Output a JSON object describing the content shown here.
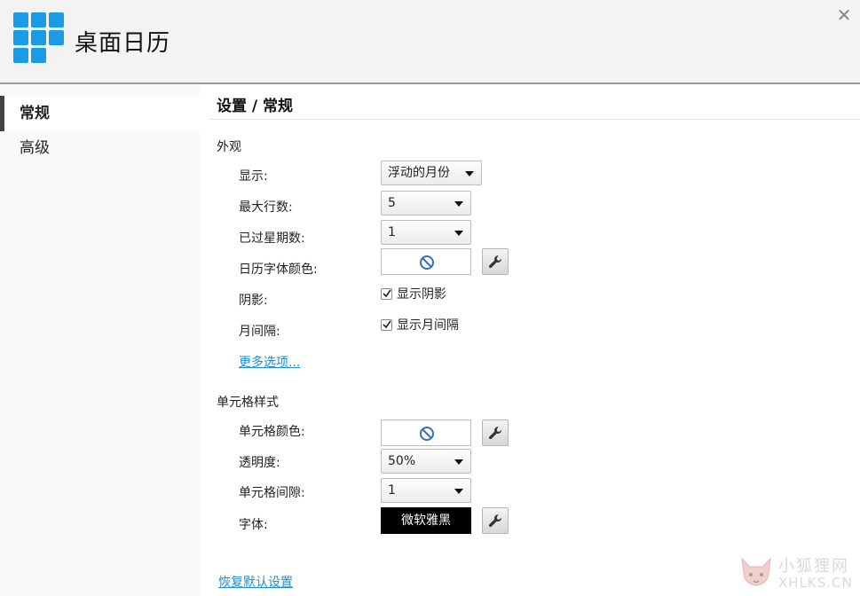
{
  "app": {
    "title": "桌面日历",
    "close_glyph": "✕"
  },
  "sidebar": {
    "items": [
      {
        "label": "常规",
        "active": true
      },
      {
        "label": "高级",
        "active": false
      }
    ]
  },
  "main": {
    "title": "设置 / 常规",
    "appearance": {
      "section_label": "外观",
      "display_label": "显示:",
      "display_value": "浮动的月份",
      "max_rows_label": "最大行数:",
      "max_rows_value": "5",
      "past_weeks_label": "已过星期数:",
      "past_weeks_value": "1",
      "font_color_label": "日历字体颜色:",
      "shadow_label": "阴影:",
      "shadow_checkbox": "显示阴影",
      "shadow_checked": true,
      "month_gap_label": "月间隔:",
      "month_gap_checkbox": "显示月间隔",
      "month_gap_checked": true,
      "more_options_link": "更多选项..."
    },
    "cell_style": {
      "section_label": "单元格样式",
      "cell_color_label": "单元格颜色:",
      "opacity_label": "透明度:",
      "opacity_value": "50%",
      "cell_gap_label": "单元格间隙:",
      "cell_gap_value": "1",
      "font_label": "字体:",
      "font_value": "微软雅黑"
    },
    "restore_link": "恢复默认设置"
  },
  "watermark": {
    "cn": "小狐狸网",
    "en": "XHLKS.CN"
  },
  "colors": {
    "accent": "#1a9be6",
    "link": "#1e8fd1"
  },
  "icons": [
    "calendar-logo-icon",
    "close-icon",
    "no-color-icon",
    "wrench-icon",
    "checkmark-icon",
    "dropdown-arrow-icon",
    "fox-icon"
  ]
}
